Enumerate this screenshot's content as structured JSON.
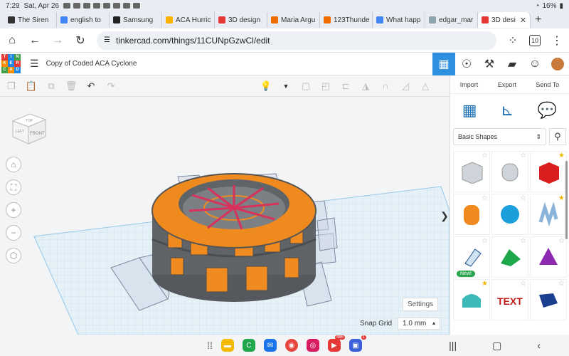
{
  "status": {
    "time": "7:29",
    "date": "Sat, Apr 26",
    "battery": "16%"
  },
  "tabs": [
    {
      "title": "The Siren",
      "color": "#333333"
    },
    {
      "title": "english to",
      "color": "#4285f4"
    },
    {
      "title": "Samsung",
      "color": "#222222"
    },
    {
      "title": "ACA Hurric",
      "color": "#ffb300"
    },
    {
      "title": "3D design",
      "color": "#e53935"
    },
    {
      "title": "Maria Argu",
      "color": "#ef6c00"
    },
    {
      "title": "123Thunde",
      "color": "#ef6c00"
    },
    {
      "title": "What happ",
      "color": "#4285f4"
    },
    {
      "title": "edgar_mar",
      "color": "#90a4ae"
    },
    {
      "title": "3D desi",
      "color": "#e53935",
      "active": true
    }
  ],
  "address": {
    "url": "tinkercad.com/things/11CUNpGzwCl/edit",
    "tab_count": "10"
  },
  "app": {
    "doc_title": "Copy of Coded ACA Cyclone",
    "logo_letters": [
      "T",
      "I",
      "N",
      "K",
      "E",
      "R",
      "C",
      "A",
      "D"
    ]
  },
  "panel": {
    "actions": [
      "Import",
      "Export",
      "Send To"
    ],
    "category": "Basic Shapes",
    "new_badge": "New!"
  },
  "workspace": {
    "settings_label": "Settings",
    "snap_label": "Snap Grid",
    "snap_value": "1.0 mm",
    "viewcube_top": "TOP",
    "viewcube_front": "FRONT",
    "viewcube_left": "LEFT"
  },
  "dock": {
    "badge1": "485",
    "badge2": "1"
  }
}
